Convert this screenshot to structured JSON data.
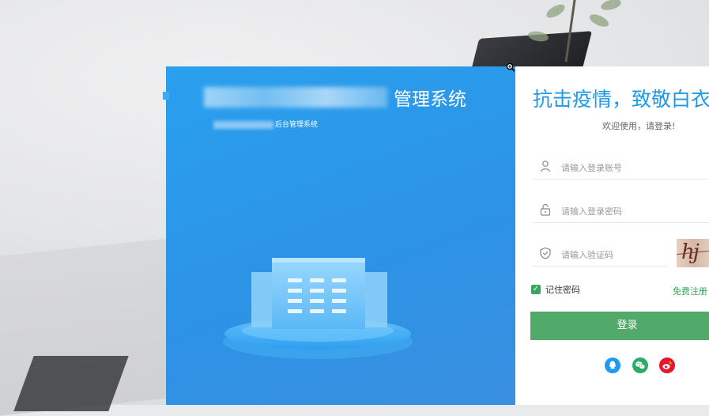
{
  "left": {
    "title": "管理系统",
    "subtitle": "后台管理系统"
  },
  "login": {
    "slogan": "抗击疫情，致敬白衣",
    "welcome": "欢迎使用，请登录!",
    "account_placeholder": "请输入登录账号",
    "password_placeholder": "请输入登录密码",
    "captcha_placeholder": "请输入验证码",
    "captcha_text": "hj",
    "remember_label": "记住密码",
    "register_label": "免费注册",
    "login_button": "登录",
    "social_icons": [
      "qq-icon",
      "wechat-icon",
      "weibo-icon"
    ]
  },
  "colors": {
    "panel_blue": "#2c93e6",
    "slogan_blue": "#1c9ae8",
    "green": "#52aa6a",
    "qq_blue": "#1e9bf0",
    "wechat_green": "#2aae67",
    "weibo_red": "#e6162d"
  }
}
